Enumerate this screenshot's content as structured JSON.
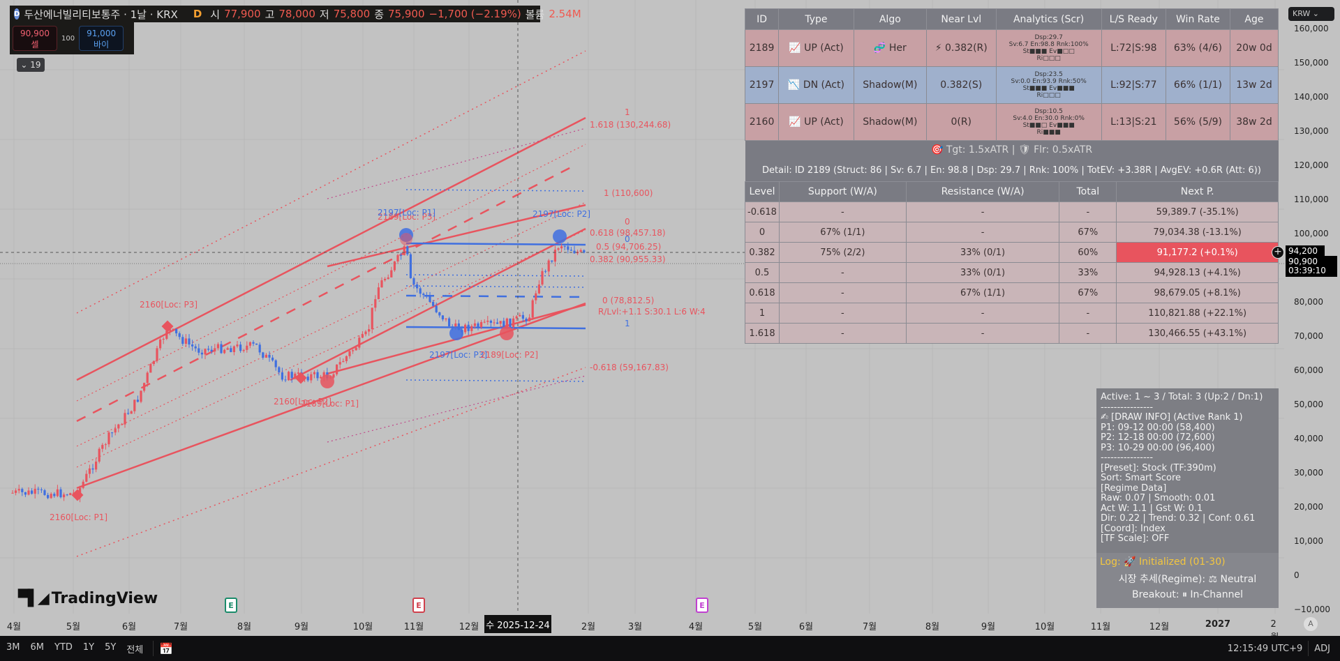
{
  "header": {
    "symbol_logo": "D",
    "title": "두산에너빌리티보통주 · 1날 · KRX",
    "interval_badge": "D",
    "open_label": "시",
    "open": "77,900",
    "high_label": "고",
    "high": "78,000",
    "low_label": "저",
    "low": "75,800",
    "close_label": "종",
    "close": "75,900",
    "change": "−1,700 (−2.19%)",
    "volume_label": "볼륨",
    "volume": "2.54M"
  },
  "trade": {
    "sell_price": "90,900",
    "sell_label": "셀",
    "qty": "100",
    "buy_price": "91,000",
    "buy_label": "바이"
  },
  "indicators_collapse": "⌄ 19",
  "signal_table": {
    "headers": [
      "ID",
      "Type",
      "Algo",
      "Near Lvl",
      "Analytics (Scr)",
      "L/S Ready",
      "Win Rate",
      "Age"
    ],
    "rows": [
      {
        "dir": "up",
        "id": "2189",
        "type": "UP (Act)",
        "type_icon": "chart-up-icon",
        "algo": "Her",
        "algo_icon": "dna-icon",
        "near": "0.382(R)",
        "near_icon": "lightning-icon",
        "an1": "Dsp:29.7",
        "an2": "Sv:6.7 En:98.8 Rnk:100%",
        "an3": "St■■■ Ev■□□",
        "an4": "Ri□□□",
        "ls": "L:72|S:98",
        "win": "63% (4/6)",
        "age": "20w 0d"
      },
      {
        "dir": "dn",
        "id": "2197",
        "type": "DN (Act)",
        "type_icon": "chart-down-icon",
        "algo": "Shadow(M)",
        "near": "0.382(S)",
        "an1": "Dsp:23.5",
        "an2": "Sv:0.0 En:93.9 Rnk:50%",
        "an3": "St■■■ Ev■■■",
        "an4": "Ri□□□",
        "ls": "L:92|S:77",
        "win": "66% (1/1)",
        "age": "13w 2d"
      },
      {
        "dir": "up",
        "id": "2160",
        "type": "UP (Act)",
        "type_icon": "chart-up-icon",
        "algo": "Shadow(M)",
        "near": "0(R)",
        "an1": "Dsp:10.5",
        "an2": "Sv:4.0 En:30.0 Rnk:0%",
        "an3": "St■■□ Ev■■■",
        "an4": "Ri■■■",
        "ls": "L:13|S:21",
        "win": "56% (5/9)",
        "age": "38w 2d"
      }
    ],
    "targets": "Tgt: 1.5xATR  |",
    "floor": "Flr: 0.5xATR",
    "detail": "Detail: ID 2189 (Struct: 86 | Sv: 6.7 | En: 98.8 | Dsp: 29.7 | Rnk: 100% | TotEV: +3.38R | AvgEV: +0.6R (Att: 6))"
  },
  "level_table": {
    "headers": [
      "Level",
      "Support (W/A)",
      "Resistance (W/A)",
      "Total",
      "Next P."
    ],
    "rows": [
      [
        "-0.618",
        "-",
        "-",
        "-",
        "59,389.7 (-35.1%)"
      ],
      [
        "0",
        "67% (1/1)",
        "-",
        "67%",
        "79,034.38 (-13.1%)"
      ],
      [
        "0.382",
        "75% (2/2)",
        "33% (0/1)",
        "60%",
        "91,177.2 (+0.1%)"
      ],
      [
        "0.5",
        "-",
        "33% (0/1)",
        "33%",
        "94,928.13 (+4.1%)"
      ],
      [
        "0.618",
        "-",
        "67% (1/1)",
        "67%",
        "98,679.05 (+8.1%)"
      ],
      [
        "1",
        "-",
        "-",
        "-",
        "110,821.88 (+22.1%)"
      ],
      [
        "1.618",
        "-",
        "-",
        "-",
        "130,466.55 (+43.1%)"
      ]
    ],
    "highlight_row": 2
  },
  "info_panel": {
    "lines": [
      "Active: 1 ~ 3 / Total: 3 (Up:2 / Dn:1)",
      "----------------",
      "✍ [DRAW INFO] (Active Rank 1)",
      "P1: 09-12 00:00 (58,400)",
      "P2: 12-18 00:00 (72,600)",
      "P3: 10-29 00:00 (96,400)",
      "----------------",
      "[Preset]: Stock (TF:390m)",
      "Sort: Smart Score",
      "[Regime Data]",
      "Raw: 0.07 | Smooth: 0.01",
      "Act W: 1.1 | Gst W: 0.1",
      "Dir: 0.22 | Trend: 0.32 | Conf: 0.61",
      "[Coord]: Index",
      "[TF Scale]: OFF"
    ],
    "log": "Log: 🚀 Initialized (01-30)",
    "regime": "시장 추세(Regime): ⚖ Neutral",
    "breakout": "Breakout: ⏸ In-Channel"
  },
  "price_axis": {
    "currency": "KRW ⌄",
    "ticks": [
      "160,000",
      "150,000",
      "140,000",
      "130,000",
      "120,000",
      "110,000",
      "100,000",
      "80,000",
      "70,000",
      "60,000",
      "50,000",
      "40,000",
      "30,000",
      "20,000",
      "10,000",
      "0",
      "−10,000"
    ],
    "crosshair_price": "94,200",
    "last_price": "90,900",
    "countdown": "03:39:10"
  },
  "time_axis": {
    "ticks": [
      "4월",
      "5월",
      "6월",
      "7월",
      "8월",
      "9월",
      "10월",
      "11월",
      "12월",
      "2월",
      "3월",
      "4월",
      "5월",
      "6월",
      "7월",
      "8월",
      "9월",
      "10월",
      "11월",
      "12월",
      "2027",
      "2월"
    ],
    "crosshair_date": "수 2025-12-24",
    "auto_button": "A"
  },
  "chart_labels": {
    "p3_2160": "2160[Loc: P3]",
    "p1_2160": "2160[Loc: P1]",
    "p2_2160": "2160[Loc: P2]",
    "p1_2189": "2189[Loc: P1]",
    "p1_2197": "2197[Loc: P1]",
    "p3_2189": "2189[Loc: P3]",
    "p2_2197": "2197[Loc: P2]",
    "p3_2197": "2197[Loc: P3]",
    "p2_2189": "2189[Loc: P2]",
    "l1_top": "1",
    "l1618": "1.618 (130,244.68)",
    "l1": "1 (110,600)",
    "l0a": "0",
    "l0618": "0.618 (98,457.18)",
    "l0b": "0",
    "l05": "0.5 (94,706.25)",
    "l0382": "0.382 (90,955.33)",
    "l0": "0 (78,812.5)",
    "rlvl": "R/Lvl:+1.1 S:30.1 L:6 W:4",
    "l1b": "1",
    "lm0618": "-0.618 (59,167.83)"
  },
  "events": [
    "E",
    "E",
    "E"
  ],
  "brand": "TradingView",
  "bottom_bar": {
    "ranges": [
      "3M",
      "6M",
      "YTD",
      "1Y",
      "5Y",
      "전체"
    ],
    "clock": "12:15:49 UTC+9",
    "adj": "ADJ"
  },
  "colors": {
    "up": "#e8545e",
    "down": "#3f6fe0",
    "chart_bg": "#c2c2c2"
  }
}
